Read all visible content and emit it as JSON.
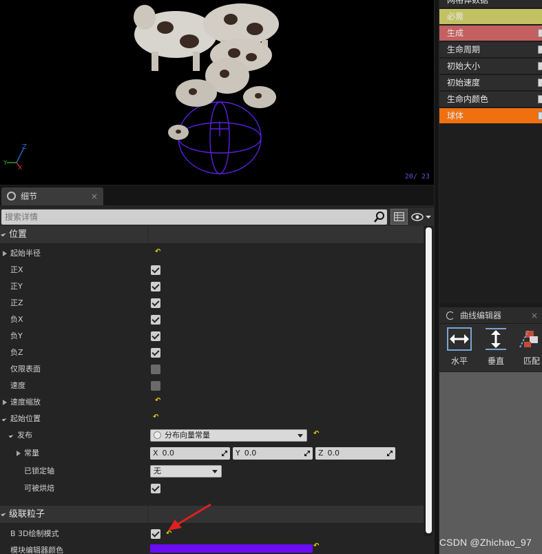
{
  "viewport": {
    "counter": "20/  23"
  },
  "emitter_stack": {
    "items": [
      {
        "label": "网格体数据",
        "bg": "#2a2a2a",
        "has_check": false
      },
      {
        "label": "必需",
        "bg": "#c2c264",
        "has_check": false
      },
      {
        "label": "生成",
        "bg": "#c46060",
        "has_check": true
      },
      {
        "label": "生命周期",
        "bg": "#2d2d2d",
        "has_check": true
      },
      {
        "label": "初始大小",
        "bg": "#2d2d2d",
        "has_check": true
      },
      {
        "label": "初始速度",
        "bg": "#2d2d2d",
        "has_check": true
      },
      {
        "label": "生命内颜色",
        "bg": "#2d2d2d",
        "has_check": true
      },
      {
        "label": "球体",
        "bg": "#f07010",
        "has_check": true
      }
    ]
  },
  "curve_editor": {
    "title": "曲线编辑器",
    "close": "×",
    "tools": [
      {
        "label": "水平",
        "icon": "fit-horizontal-icon"
      },
      {
        "label": "垂直",
        "icon": "fit-vertical-icon"
      },
      {
        "label": "匹配",
        "icon": "fit-match-icon"
      }
    ]
  },
  "details": {
    "tab_label": "细节",
    "tab_close": "×",
    "search_placeholder": "搜索详情",
    "categories": {
      "position": "位置",
      "cascade": "级联粒子"
    },
    "rows": {
      "start_radius": "起始半径",
      "pos_x": "正X",
      "pos_y": "正Y",
      "pos_z": "正Z",
      "neg_x": "负X",
      "neg_y": "负Y",
      "neg_z": "负Z",
      "surface_only": "仅限表面",
      "velocity": "速度",
      "velocity_scale": "速度缩放",
      "start_location": "起始位置",
      "distribution": "发布",
      "constant": "常量",
      "locked_axes": "已锁定轴",
      "can_bake": "可被烘焙",
      "b3d_draw_mode": "B 3D绘制模式",
      "module_editor_color": "模块编辑器颜色"
    },
    "checks": {
      "pos_x": true,
      "pos_y": true,
      "pos_z": true,
      "neg_x": true,
      "neg_y": true,
      "neg_z": true,
      "surface_only": false,
      "velocity": false,
      "can_bake": true,
      "b3d_draw_mode": true
    },
    "distribution_value": "分布向量常量",
    "constant": {
      "x_axis": "X",
      "x_value": "0.0",
      "y_axis": "Y",
      "y_value": "0.0",
      "z_axis": "Z",
      "z_value": "0.0"
    },
    "locked_axes_value": "无",
    "module_color": "#6a0cf4",
    "reset_glyph": "↶"
  },
  "watermark": "CSDN @Zhichao_97",
  "colors": {
    "annotation_arrow": "#e02020",
    "reset_icon": "#e8d20a",
    "sphere_gizmo": "#5a20e0"
  }
}
